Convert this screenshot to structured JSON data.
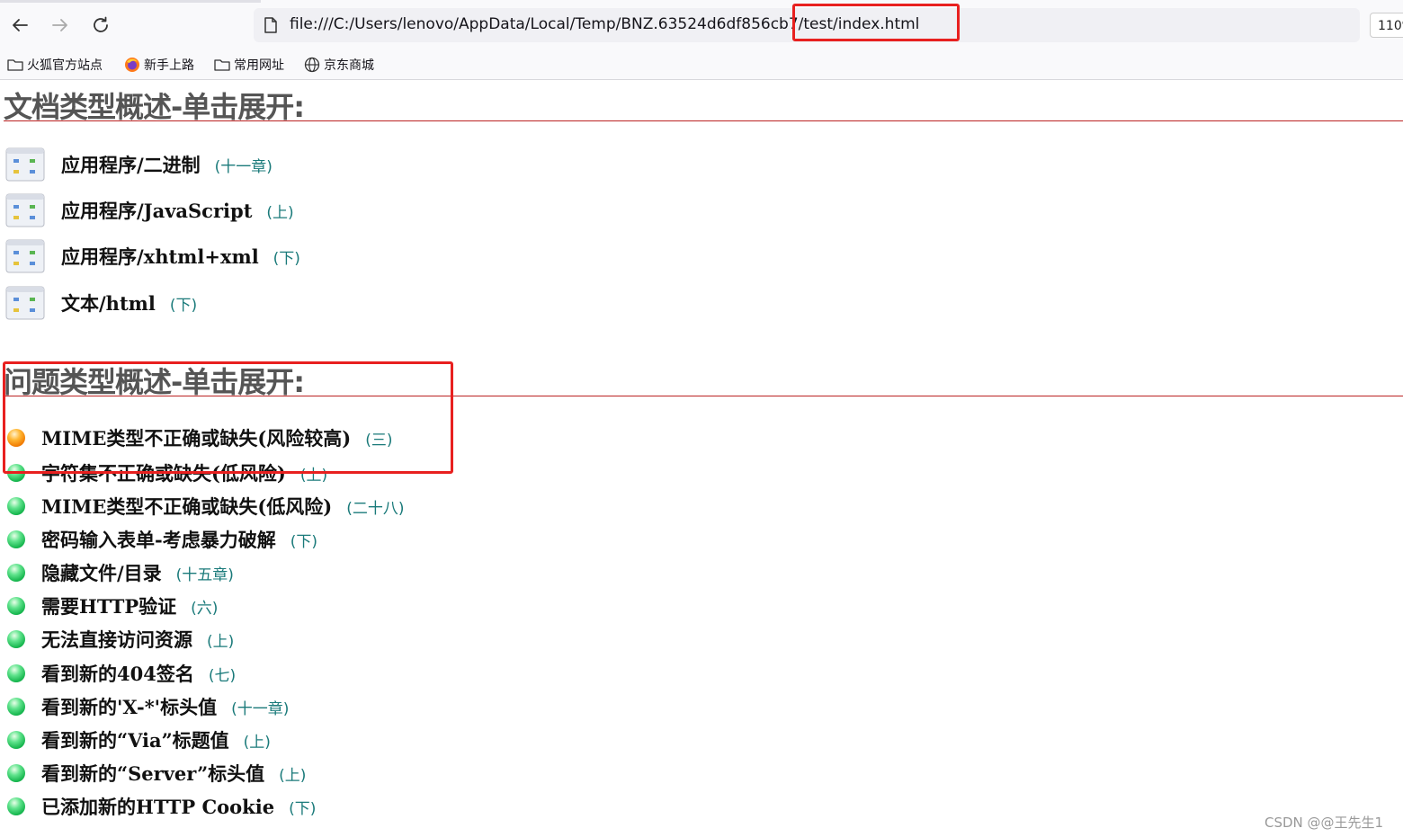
{
  "browser": {
    "url": "file:///C:/Users/lenovo/AppData/Local/Temp/BNZ.63524d6df856cb7/test/index.html",
    "zoom": "110%",
    "bookmarks": [
      {
        "label": "火狐官方站点",
        "icon": "folder-icon"
      },
      {
        "label": "新手上路",
        "icon": "firefox-icon"
      },
      {
        "label": "常用网址",
        "icon": "folder-icon"
      },
      {
        "label": "京东商城",
        "icon": "globe-icon"
      }
    ]
  },
  "doc_section": {
    "title": "文档类型概述-单击展开:",
    "items": [
      {
        "name": "应用程序/二进制",
        "note": "(十一章)"
      },
      {
        "name": "应用程序/JavaScript",
        "note": "(上)"
      },
      {
        "name": "应用程序/xhtml+xml",
        "note": "(下)"
      },
      {
        "name": "文本/html",
        "note": "(下)"
      }
    ]
  },
  "issue_section": {
    "title": "问题类型概述-单击展开:",
    "items": [
      {
        "name": "MIME类型不正确或缺失(风险较高)",
        "note": "(三)",
        "status": "orange"
      },
      {
        "name": "字符集不正确或缺失(低风险)",
        "note": "(上)",
        "status": "green"
      },
      {
        "name": "MIME类型不正确或缺失(低风险)",
        "note": "(二十八)",
        "status": "green"
      },
      {
        "name": "密码输入表单-考虑暴力破解",
        "note": "(下)",
        "status": "green"
      },
      {
        "name": "隐藏文件/目录",
        "note": "(十五章)",
        "status": "green"
      },
      {
        "name": "需要HTTP验证",
        "note": "(六)",
        "status": "green"
      },
      {
        "name": "无法直接访问资源",
        "note": "(上)",
        "status": "green"
      },
      {
        "name": "看到新的404签名",
        "note": "(七)",
        "status": "green"
      },
      {
        "name": "看到新的'X-*'标头值",
        "note": "(十一章)",
        "status": "green"
      },
      {
        "name": "看到新的“Via”标题值",
        "note": "(上)",
        "status": "green"
      },
      {
        "name": "看到新的“Server”标头值",
        "note": "(上)",
        "status": "green"
      },
      {
        "name": "已添加新的HTTP Cookie",
        "note": "(下)",
        "status": "green"
      }
    ]
  },
  "watermark": "CSDN @@王先生1",
  "colors": {
    "annotation_red": "#e8201f",
    "note_teal": "#1a7a7a",
    "rule_red": "#b22222"
  }
}
